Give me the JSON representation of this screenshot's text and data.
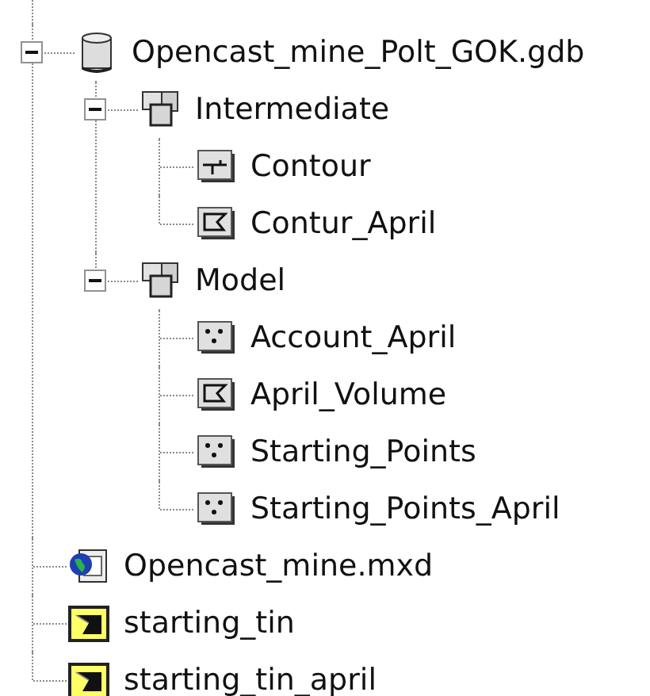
{
  "tree": [
    {
      "label": "Opencast_mine_Polt_GOK.gdb",
      "kind": "geodatabase",
      "expanded": true,
      "children": [
        {
          "label": "Intermediate",
          "kind": "dataset",
          "expanded": true,
          "children": [
            {
              "label": "Contour",
              "kind": "line-class"
            },
            {
              "label": "Contur_April",
              "kind": "polygon-class"
            }
          ]
        },
        {
          "label": "Model",
          "kind": "dataset",
          "expanded": true,
          "children": [
            {
              "label": "Account_April",
              "kind": "point-class"
            },
            {
              "label": "April_Volume",
              "kind": "polygon-class"
            },
            {
              "label": "Starting_Points",
              "kind": "point-class"
            },
            {
              "label": "Starting_Points_April",
              "kind": "point-class"
            }
          ]
        }
      ]
    },
    {
      "label": "Opencast_mine.mxd",
      "kind": "map-document"
    },
    {
      "label": "starting_tin",
      "kind": "tin"
    },
    {
      "label": "starting_tin_april",
      "kind": "tin"
    }
  ]
}
